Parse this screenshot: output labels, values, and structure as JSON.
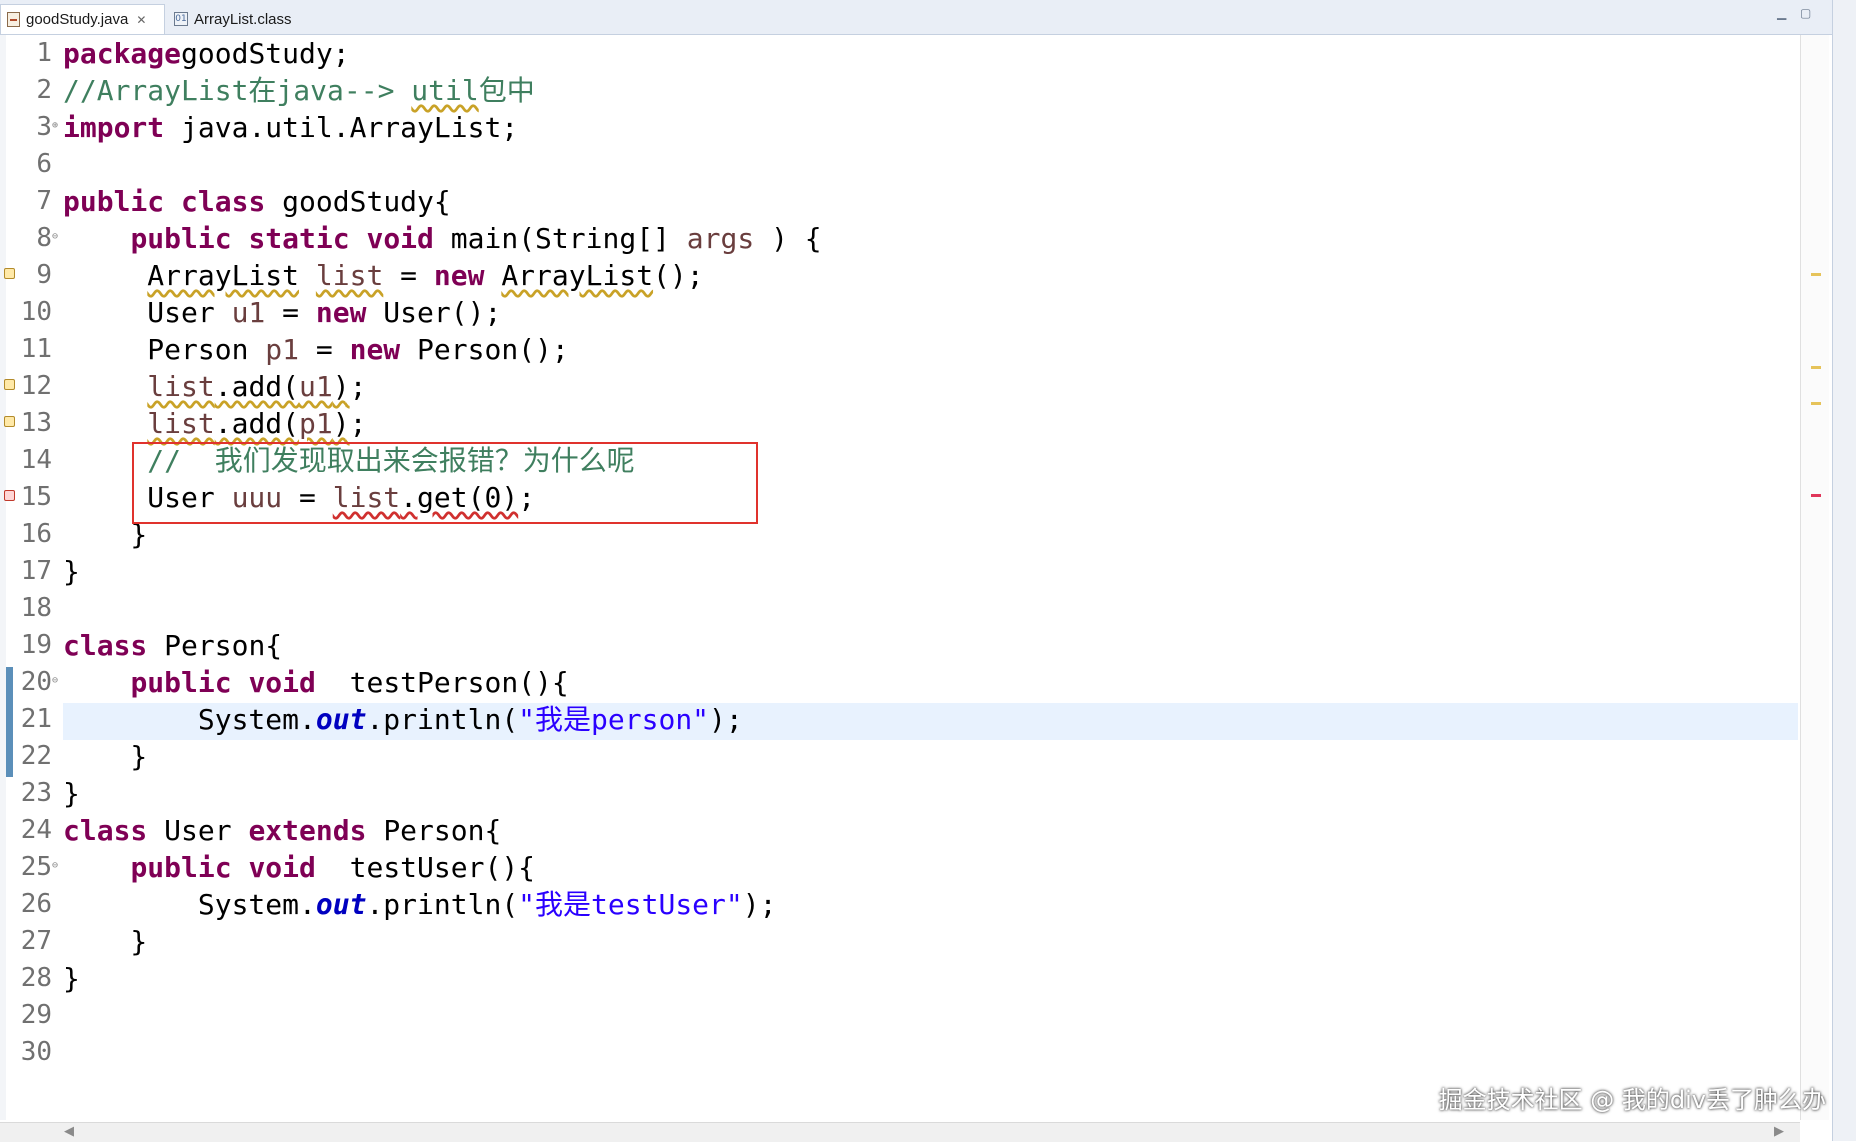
{
  "tabs": [
    {
      "label": "goodStudy.java",
      "icon": "java-file-icon",
      "active": true
    },
    {
      "label": "ArrayList.class",
      "icon": "class-file-icon",
      "active": false
    }
  ],
  "lines": [
    {
      "n": "1",
      "code": [
        [
          "kw",
          "package"
        ],
        [
          "",
          "goodStudy;"
        ]
      ]
    },
    {
      "n": "2",
      "code": [
        [
          "cm",
          "//ArrayList在java--> "
        ],
        [
          "cm warn",
          "util"
        ],
        [
          "cm",
          "包中"
        ]
      ]
    },
    {
      "n": "3",
      "code": [
        [
          "kw",
          "import"
        ],
        [
          "",
          " java.util.ArrayList;"
        ]
      ]
    },
    {
      "n": "6",
      "code": []
    },
    {
      "n": "7",
      "code": [
        [
          "kw",
          "public"
        ],
        [
          "",
          " "
        ],
        [
          "kw",
          "class"
        ],
        [
          "",
          " goodStudy{"
        ]
      ]
    },
    {
      "n": "8",
      "code": [
        [
          "",
          "    "
        ],
        [
          "kw",
          "public"
        ],
        [
          "",
          " "
        ],
        [
          "kw",
          "static"
        ],
        [
          "",
          " "
        ],
        [
          "kw",
          "void"
        ],
        [
          "",
          " main(String[] "
        ],
        [
          "var",
          "args"
        ],
        [
          "",
          " ) {"
        ]
      ]
    },
    {
      "n": "9",
      "code": [
        [
          "",
          "     "
        ],
        [
          "warn",
          "ArrayList"
        ],
        [
          "",
          " "
        ],
        [
          "var warn",
          "list"
        ],
        [
          "",
          " = "
        ],
        [
          "kw",
          "new"
        ],
        [
          "",
          " "
        ],
        [
          "warn",
          "ArrayList"
        ],
        [
          "",
          "();"
        ]
      ]
    },
    {
      "n": "10",
      "code": [
        [
          "",
          "     User "
        ],
        [
          "var",
          "u1"
        ],
        [
          "",
          " = "
        ],
        [
          "kw",
          "new"
        ],
        [
          "",
          " User();"
        ]
      ]
    },
    {
      "n": "11",
      "code": [
        [
          "",
          "     Person "
        ],
        [
          "var",
          "p1"
        ],
        [
          "",
          " = "
        ],
        [
          "kw",
          "new"
        ],
        [
          "",
          " Person();"
        ]
      ]
    },
    {
      "n": "12",
      "code": [
        [
          "",
          "     "
        ],
        [
          "var warn",
          "list"
        ],
        [
          "warn",
          ".add("
        ],
        [
          "var warn",
          "u1"
        ],
        [
          "warn",
          ")"
        ],
        [
          "",
          ";"
        ]
      ]
    },
    {
      "n": "13",
      "code": [
        [
          "",
          "     "
        ],
        [
          "var warn",
          "list"
        ],
        [
          "warn",
          ".add("
        ],
        [
          "var warn",
          "p1"
        ],
        [
          "warn",
          ")"
        ],
        [
          "",
          ";"
        ]
      ]
    },
    {
      "n": "14",
      "code": [
        [
          "",
          "     "
        ],
        [
          "cm",
          "//  我们发现取出来会报错？为什么呢"
        ]
      ]
    },
    {
      "n": "15",
      "code": [
        [
          "",
          "     User "
        ],
        [
          "var",
          "uuu"
        ],
        [
          "",
          " = "
        ],
        [
          "var errw",
          "list"
        ],
        [
          "errw",
          ".get(0)"
        ],
        [
          "",
          ";"
        ]
      ]
    },
    {
      "n": "16",
      "code": [
        [
          "",
          "    }"
        ]
      ]
    },
    {
      "n": "17",
      "code": [
        [
          "",
          "}"
        ]
      ]
    },
    {
      "n": "18",
      "code": []
    },
    {
      "n": "19",
      "code": [
        [
          "kw",
          "class"
        ],
        [
          "",
          " Person{"
        ]
      ]
    },
    {
      "n": "20",
      "code": [
        [
          "",
          "    "
        ],
        [
          "kw",
          "public"
        ],
        [
          "",
          " "
        ],
        [
          "kw",
          "void"
        ],
        [
          "",
          "  testPerson(){"
        ]
      ]
    },
    {
      "n": "21",
      "code": [
        [
          "",
          "        System."
        ],
        [
          "fld",
          "out"
        ],
        [
          "",
          ".println("
        ],
        [
          "str",
          "\"我是person\""
        ],
        [
          "",
          ");"
        ]
      ]
    },
    {
      "n": "22",
      "code": [
        [
          "",
          "    }"
        ]
      ]
    },
    {
      "n": "23",
      "code": [
        [
          "",
          "}"
        ]
      ]
    },
    {
      "n": "24",
      "code": [
        [
          "kw",
          "class"
        ],
        [
          "",
          " User "
        ],
        [
          "kw",
          "extends"
        ],
        [
          "",
          " Person{"
        ]
      ]
    },
    {
      "n": "25",
      "code": [
        [
          "",
          "    "
        ],
        [
          "kw",
          "public"
        ],
        [
          "",
          " "
        ],
        [
          "kw",
          "void"
        ],
        [
          "",
          "  testUser(){"
        ]
      ]
    },
    {
      "n": "26",
      "code": [
        [
          "",
          "        System."
        ],
        [
          "fld",
          "out"
        ],
        [
          "",
          ".println("
        ],
        [
          "str",
          "\"我是testUser\""
        ],
        [
          "",
          ");"
        ]
      ]
    },
    {
      "n": "27",
      "code": [
        [
          "",
          "    }"
        ]
      ]
    },
    {
      "n": "28",
      "code": [
        [
          "",
          "}"
        ]
      ]
    },
    {
      "n": "29",
      "code": []
    },
    {
      "n": "30",
      "code": []
    }
  ],
  "watermark": "掘金技术社区 @ 我的div丢了肿么办",
  "colors": {
    "keyword": "#7f0055",
    "comment": "#3f7f5f",
    "string": "#2a00ff",
    "annotation_box": "#e0322d",
    "current_line": "#e8f2fe"
  }
}
